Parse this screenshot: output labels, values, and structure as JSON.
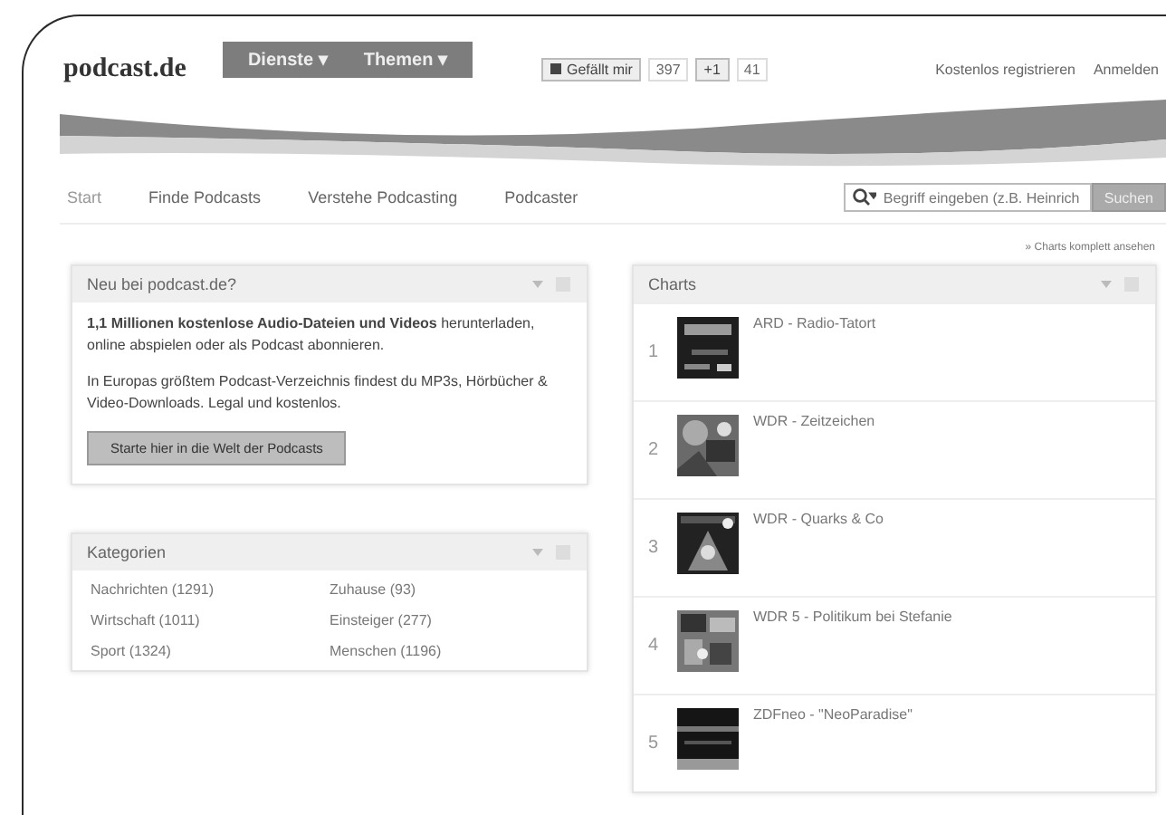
{
  "header": {
    "logo": "podcast.de",
    "menus": [
      {
        "label": "Dienste ▾"
      },
      {
        "label": "Themen ▾"
      }
    ],
    "social": [
      {
        "kind": "like",
        "label": "Gefällt mir",
        "count": "397"
      },
      {
        "kind": "plus",
        "label": "+1",
        "count": "41"
      }
    ],
    "links": [
      "Kostenlos registrieren",
      "Anmelden"
    ]
  },
  "nav": {
    "items": [
      {
        "label": "Start",
        "selected": true
      },
      {
        "label": "Finde Podcasts",
        "selected": false
      },
      {
        "label": "Verstehe Podcasting",
        "selected": false
      },
      {
        "label": "Podcaster",
        "selected": false
      }
    ],
    "search": {
      "placeholder": "Begriff eingeben (z.B. Heinrich",
      "button": "Suchen"
    }
  },
  "charts_link": "» Charts komplett ansehen",
  "intro": {
    "title": "Neu bei podcast.de?",
    "paragraphs": [
      "**1,1 Millionen kostenlose Audio-Dateien und Videos** herunterladen, online abspielen oder als Podcast abonnieren.",
      "In Europas größtem Podcast-Verzeichnis findest du MP3s, Hörbücher & Video-Downloads. Legal und kostenlos."
    ],
    "button": "Starte hier in die Welt der Podcasts"
  },
  "categories": {
    "title": "Kategorien",
    "items": [
      "Nachrichten (1291)",
      "Zuhause (93)",
      "Wirtschaft (1011)",
      "Einsteiger (277)",
      "Sport (1324)",
      "Menschen (1196)"
    ]
  },
  "charts": {
    "title": "Charts",
    "rows": [
      {
        "rank": "1",
        "title": "ARD - Radio-Tatort"
      },
      {
        "rank": "2",
        "title": "WDR - Zeitzeichen"
      },
      {
        "rank": "3",
        "title": "WDR - Quarks & Co"
      },
      {
        "rank": "4",
        "title": "WDR 5 - Politikum bei Stefanie"
      },
      {
        "rank": "5",
        "title": "ZDFneo - \"NeoParadise\""
      }
    ]
  }
}
